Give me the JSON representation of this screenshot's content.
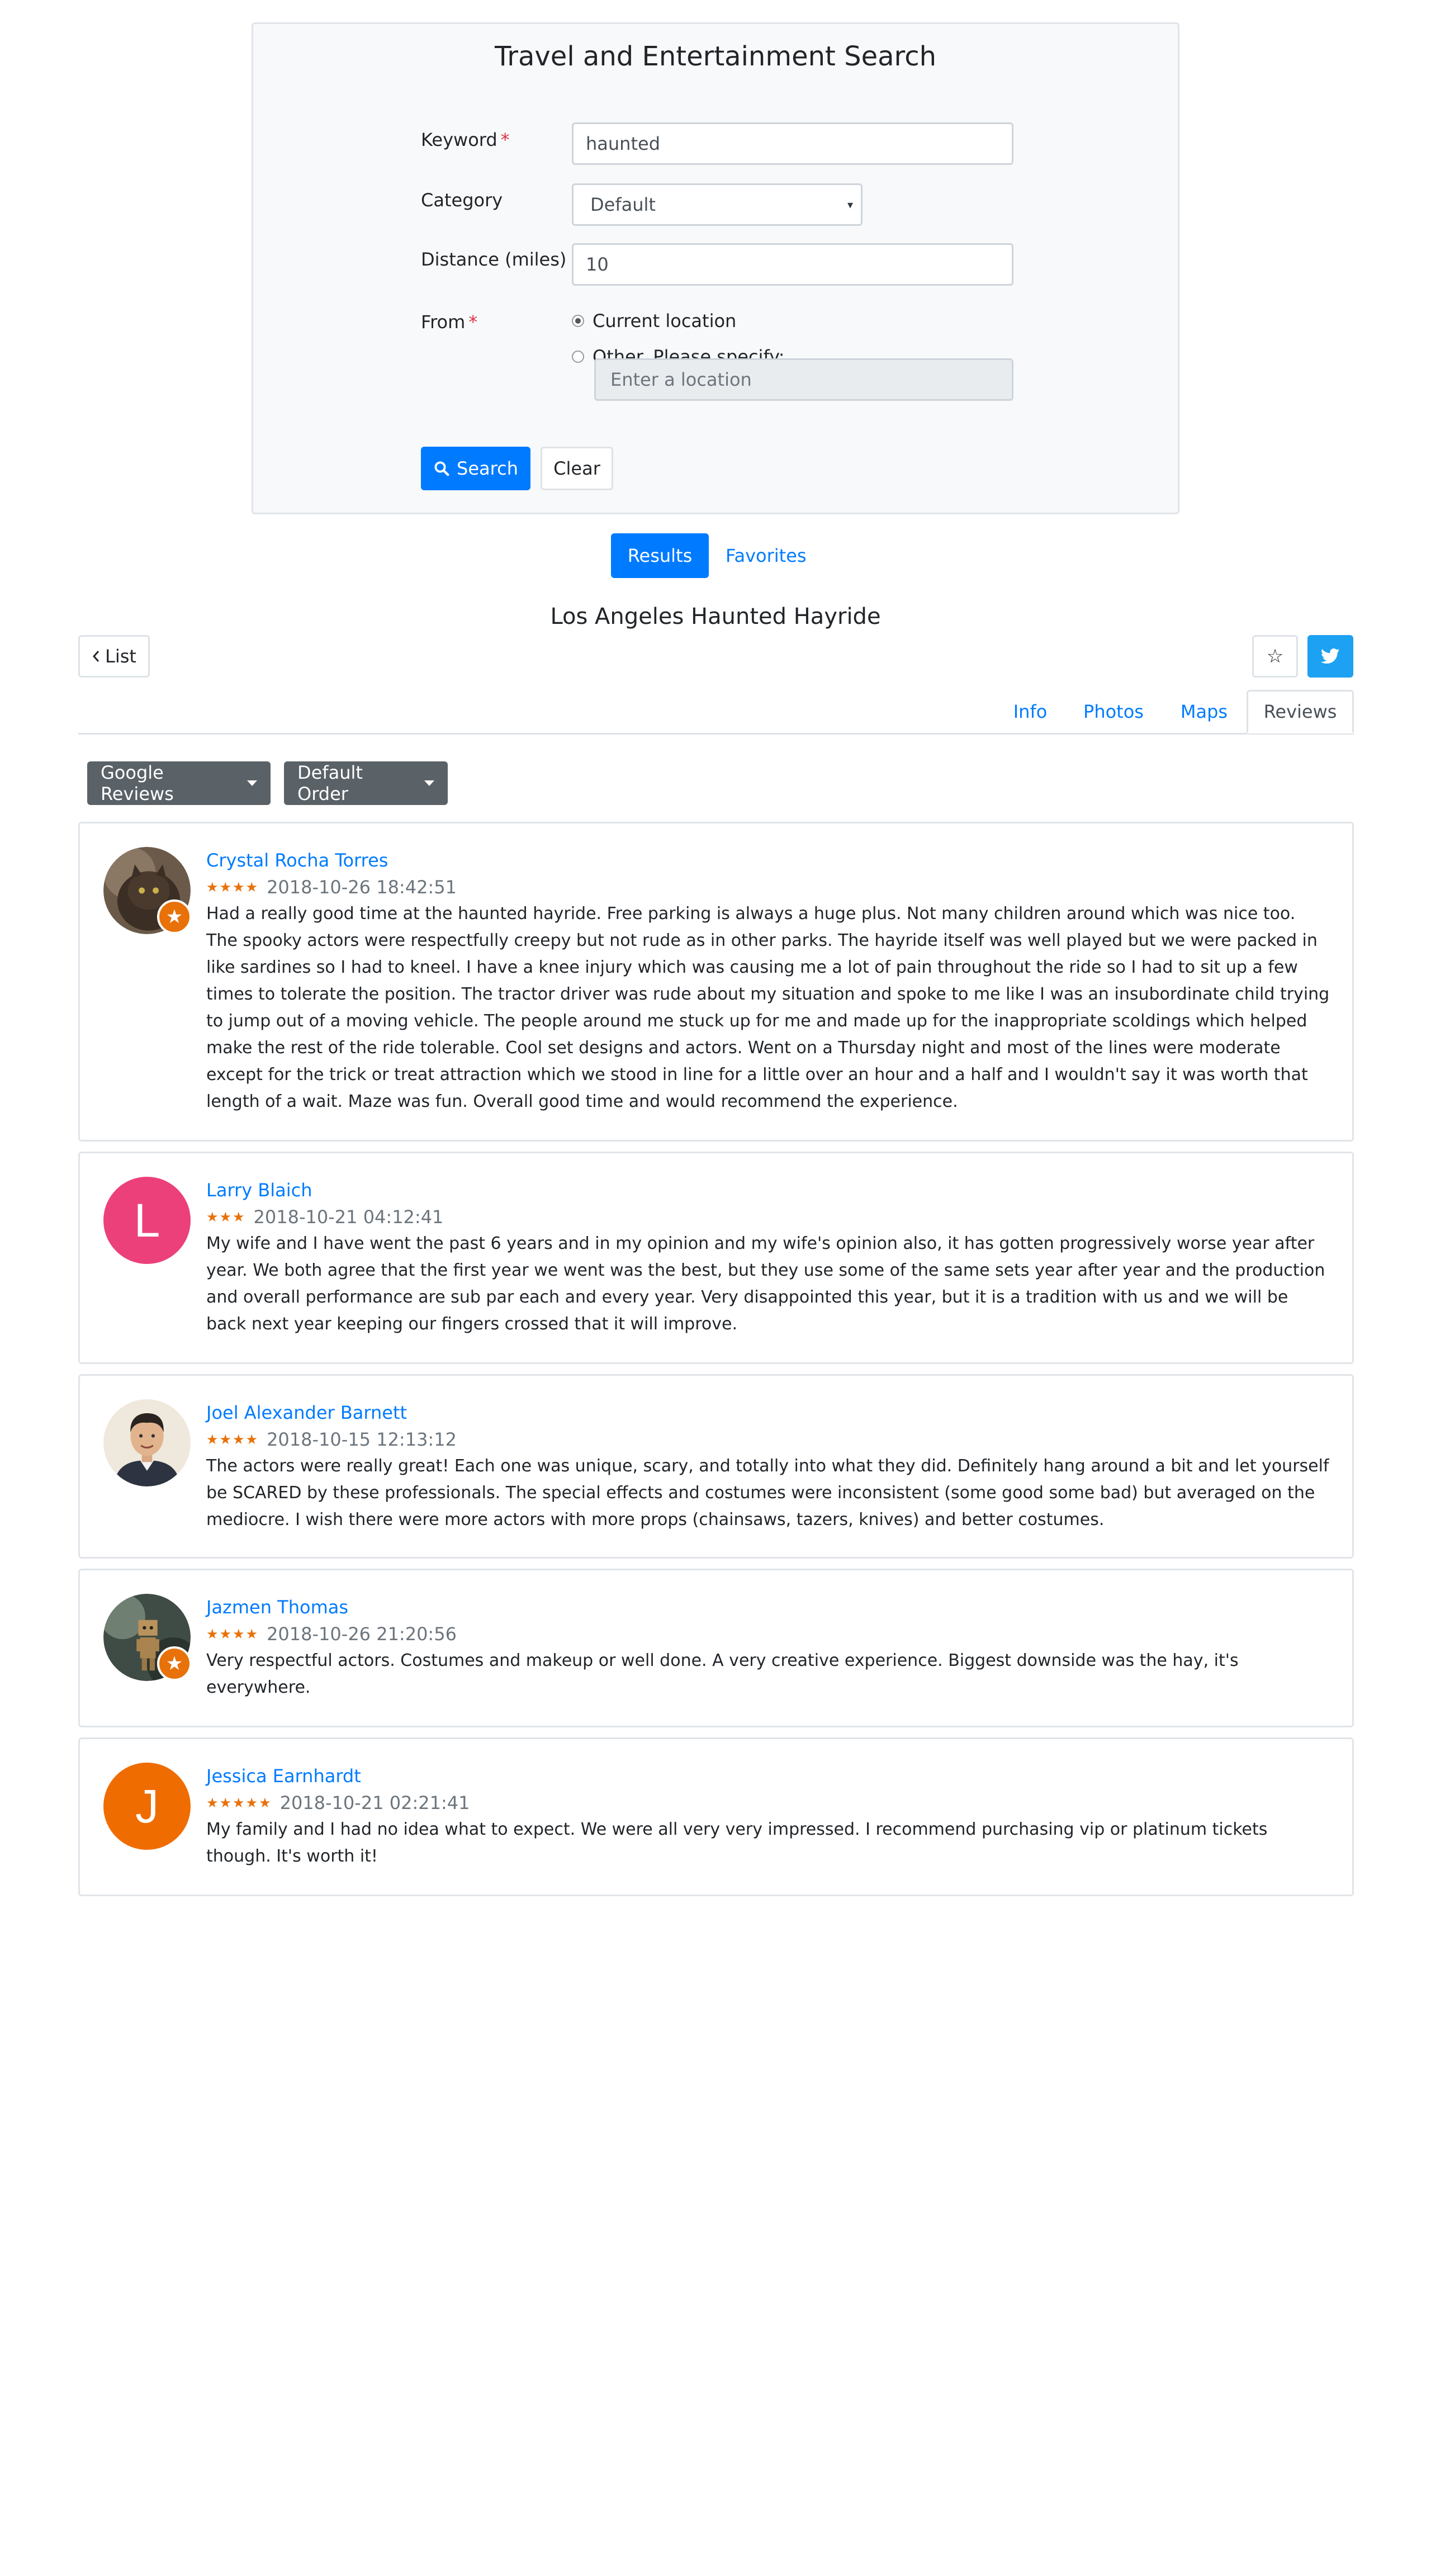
{
  "form": {
    "title": "Travel and Entertainment Search",
    "keyword_label": "Keyword",
    "keyword_value": "haunted",
    "required_mark": "*",
    "category_label": "Category",
    "category_value": "Default",
    "distance_label": "Distance (miles)",
    "distance_value": "10",
    "from_label": "From",
    "option_current": "Current location",
    "option_other": "Other. Please specify:",
    "location_placeholder": "Enter a location",
    "search_button": "Search",
    "clear_button": "Clear"
  },
  "toggle": {
    "results": "Results",
    "favorites": "Favorites"
  },
  "place": {
    "title": "Los Angeles Haunted Hayride",
    "list_button": "List"
  },
  "tabs": [
    "Info",
    "Photos",
    "Maps",
    "Reviews"
  ],
  "active_tab": "Reviews",
  "dropdowns": {
    "source": "Google Reviews",
    "order": "Default Order"
  },
  "colors": {
    "primary": "#007bff",
    "twitter": "#1da1f2",
    "star": "#e8710a",
    "dropdown": "#5a6268"
  },
  "reviews": [
    {
      "author": "Crystal Rocha Torres",
      "rating": 4,
      "stars": "★★★★",
      "time": "2018-10-26 18:42:51",
      "avatar": "photo-cat",
      "text": "Had a really good time at the haunted hayride. Free parking is always a huge plus. Not many children around which was nice too. The spooky actors were respectfully creepy but not rude as in other parks. The hayride itself was well played but we were packed in like sardines so I had to kneel. I have a knee injury which was causing me a lot of pain throughout the ride so I had to sit up a few times to tolerate the position. The tractor driver was rude about my situation and spoke to me like I was an insubordinate child trying to jump out of a moving vehicle. The people around me stuck up for me and made up for the inappropriate scoldings which helped make the rest of the ride tolerable. Cool set designs and actors. Went on a Thursday night and most of the lines were moderate except for the trick or treat attraction which we stood in line for a little over an hour and a half and I wouldn't say it was worth that length of a wait. Maze was fun. Overall good time and would recommend the experience."
    },
    {
      "author": "Larry Blaich",
      "rating": 3,
      "stars": "★★★",
      "time": "2018-10-21 04:12:41",
      "avatar_letter": "L",
      "avatar_color": "#ec407a",
      "text": "My wife and I have went the past 6 years and in my opinion and my wife's opinion also, it has gotten progressively worse year after year. We both agree that the first year we went was the best, but they use some of the same sets year after year and the production and overall performance are sub par each and every year. Very disappointed this year, but it is a tradition with us and we will be back next year keeping our fingers crossed that it will improve."
    },
    {
      "author": "Joel Alexander Barnett",
      "rating": 4,
      "stars": "★★★★",
      "time": "2018-10-15 12:13:12",
      "avatar": "photo-man",
      "text": "The actors were really great! Each one was unique, scary, and totally into what they did. Definitely hang around a bit and let yourself be SCARED by these professionals. The special effects and costumes were inconsistent (some good some bad) but averaged on the mediocre. I wish there were more actors with more props (chainsaws, tazers, knives) and better costumes."
    },
    {
      "author": "Jazmen Thomas",
      "rating": 4,
      "stars": "★★★★",
      "time": "2018-10-26 21:20:56",
      "avatar": "photo-figure",
      "text": "Very respectful actors. Costumes and makeup or well done. A very creative experience. Biggest downside was the hay, it's everywhere."
    },
    {
      "author": "Jessica Earnhardt",
      "rating": 5,
      "stars": "★★★★★",
      "time": "2018-10-21 02:21:41",
      "avatar_letter": "J",
      "avatar_color": "#ef6c00",
      "text": "My family and I had no idea what to expect. We were all very very impressed. I recommend purchasing vip or platinum tickets though. It's worth it!"
    }
  ]
}
